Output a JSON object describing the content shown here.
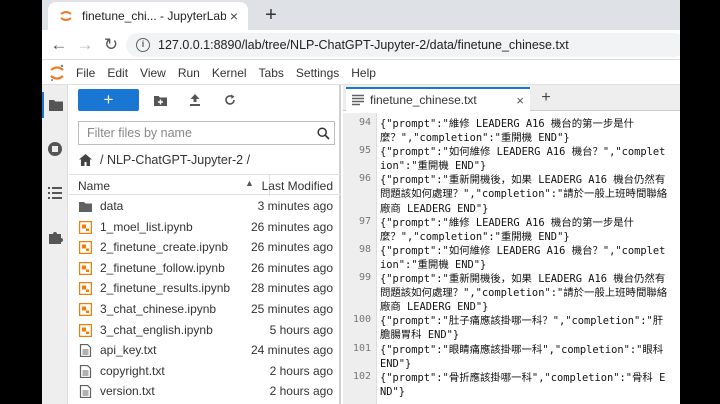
{
  "browser": {
    "tab_title": "finetune_chi... - JupyterLab",
    "tab_close": "×",
    "new_tab": "+",
    "url": "127.0.0.1:8890/lab/tree/NLP-ChatGPT-Jupyter-2/data/finetune_chinese.txt"
  },
  "menu": [
    "File",
    "Edit",
    "View",
    "Run",
    "Kernel",
    "Tabs",
    "Settings",
    "Help"
  ],
  "filebrowser": {
    "new_label": "+",
    "filter_placeholder": "Filter files by name",
    "breadcrumb": "/ NLP-ChatGPT-Jupyter-2 /",
    "col_name": "Name",
    "col_modified": "Last Modified",
    "files": [
      {
        "name": "data",
        "time": "3 minutes ago",
        "icon": "folder-icon"
      },
      {
        "name": "1_moel_list.ipynb",
        "time": "26 minutes ago",
        "icon": "notebook-icon"
      },
      {
        "name": "2_finetune_create.ipynb",
        "time": "26 minutes ago",
        "icon": "notebook-icon"
      },
      {
        "name": "2_finetune_follow.ipynb",
        "time": "26 minutes ago",
        "icon": "notebook-icon"
      },
      {
        "name": "2_finetune_results.ipynb",
        "time": "28 minutes ago",
        "icon": "notebook-icon"
      },
      {
        "name": "3_chat_chinese.ipynb",
        "time": "25 minutes ago",
        "icon": "notebook-icon"
      },
      {
        "name": "3_chat_english.ipynb",
        "time": "5 hours ago",
        "icon": "notebook-icon"
      },
      {
        "name": "api_key.txt",
        "time": "24 minutes ago",
        "icon": "text-file-icon"
      },
      {
        "name": "copyright.txt",
        "time": "2 hours ago",
        "icon": "text-file-icon"
      },
      {
        "name": "version.txt",
        "time": "2 hours ago",
        "icon": "text-file-icon"
      }
    ]
  },
  "editor": {
    "tab_title": "finetune_chinese.txt",
    "tab_close": "×",
    "add_tab": "+",
    "lines": [
      {
        "n": "94",
        "text": "{\"prompt\":\"維修 LEADERG A16 機台的第一步是什麼？\",\"completion\":\"重開機 END\"}"
      },
      {
        "n": "95",
        "text": "{\"prompt\":\"如何維修 LEADERG A16 機台？\",\"completion\":\"重開機 END\"}"
      },
      {
        "n": "96",
        "text": "{\"prompt\":\"重新開機後，如果 LEADERG A16 機台仍然有問題該如何處理？\",\"completion\":\"請於一般上班時間聯絡廠商 LEADERG END\"}"
      },
      {
        "n": "97",
        "text": "{\"prompt\":\"維修 LEADERG A16 機台的第一步是什麼？\",\"completion\":\"重開機 END\"}"
      },
      {
        "n": "98",
        "text": "{\"prompt\":\"如何維修 LEADERG A16 機台？\",\"completion\":\"重開機 END\"}"
      },
      {
        "n": "99",
        "text": "{\"prompt\":\"重新開機後，如果 LEADERG A16 機台仍然有問題該如何處理？\",\"completion\":\"請於一般上班時間聯絡廠商 LEADERG END\"}"
      },
      {
        "n": "100",
        "text": "{\"prompt\":\"肚子痛應該掛哪一科？\",\"completion\":\"肝膽腸胃科 END\"}"
      },
      {
        "n": "101",
        "text": "{\"prompt\":\"眼睛痛應該掛哪一科\",\"completion\":\"眼科 END\"}"
      },
      {
        "n": "102",
        "text": "{\"prompt\":\"骨折應該掛哪一科\",\"completion\":\"骨科 END\"}"
      }
    ]
  },
  "colors": {
    "accent": "#1976d2",
    "notebook": "#f57c00",
    "jupyter": "#f37726"
  }
}
